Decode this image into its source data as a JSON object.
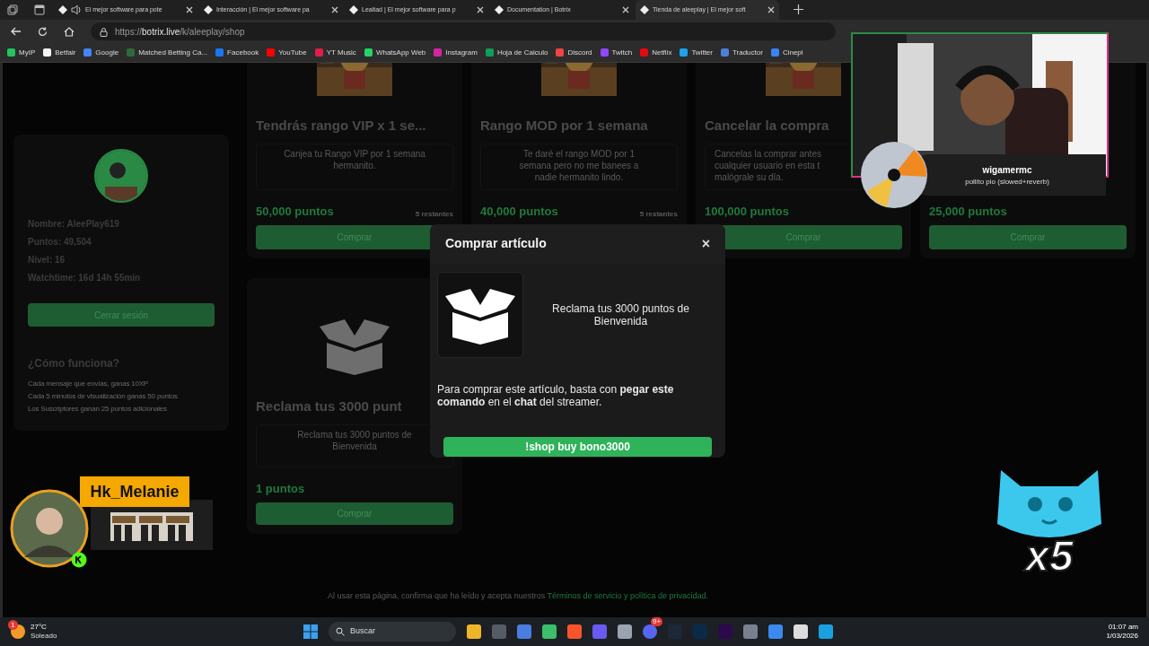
{
  "tabs": [
    {
      "title": "El mejor software para pote",
      "audio": true,
      "selected": false
    },
    {
      "title": "Interacción | El mejor software pa",
      "audio": false,
      "selected": false
    },
    {
      "title": "Lealtad | El mejor software para p",
      "audio": false,
      "selected": false
    },
    {
      "title": "Documentation | Botrix",
      "audio": false,
      "selected": false
    },
    {
      "title": "Tienda de aleeplay | El mejor soft",
      "audio": false,
      "selected": true
    }
  ],
  "address": {
    "prefix": "https://",
    "host": "botrix.live",
    "path": "/k/aleeplay/shop"
  },
  "bookmarks": [
    {
      "label": "MyIP",
      "color": "#22c55e"
    },
    {
      "label": "Betfair",
      "color": "#f5f5f5"
    },
    {
      "label": "Google",
      "color": "#4285f4"
    },
    {
      "label": "Matched Betting Ca...",
      "color": "#2f6b3a"
    },
    {
      "label": "Facebook",
      "color": "#1877f2"
    },
    {
      "label": "YouTube",
      "color": "#ff0000"
    },
    {
      "label": "YT Music",
      "color": "#e11d48"
    },
    {
      "label": "WhatsApp Web",
      "color": "#25d366"
    },
    {
      "label": "Instagram",
      "color": "#d6249f"
    },
    {
      "label": "Hoja de Calculo",
      "color": "#0f9d58"
    },
    {
      "label": "Discord",
      "color": "#ef4444"
    },
    {
      "label": "Twitch",
      "color": "#9146ff"
    },
    {
      "label": "Netflix",
      "color": "#e50914"
    },
    {
      "label": "Twitter",
      "color": "#1da1f2"
    },
    {
      "label": "Traductor",
      "color": "#4f7fd9"
    },
    {
      "label": "Cinepl",
      "color": "#3b82f6"
    }
  ],
  "profile": {
    "lines": [
      "Nombre: AleePlay619",
      "Puntos: 49,504",
      "Nivel: 16",
      "Watchtime: 16d 14h 55min"
    ],
    "logout": "Cerrar sesión",
    "how_title": "¿Cómo funciona?",
    "how_lines": [
      "Cada mensaje que envías, ganas 10XP",
      "Cada 5 minutos de visualización ganas 50 puntos",
      "Los Suscriptores ganan 25 puntos adicionales"
    ]
  },
  "cards": [
    {
      "kind": "picture",
      "title": "Tendrás rango VIP x 1 se...",
      "description": "Canjea tu Rango VIP por 1 semana\nhermanito.",
      "price": "50,000 puntos",
      "stock": "5 restantes",
      "button": "Comprar"
    },
    {
      "kind": "picture",
      "title": "Rango MOD por 1 semana",
      "description": "Te daré el rango MOD por 1\nsemana pero no me banees a\nnadie hermanito lindo.",
      "price": "40,000 puntos",
      "stock": "5 restantes"
    },
    {
      "kind": "picture",
      "title": "Cancelar la compra",
      "description": "Cancelas la comprar antes\ncualquier usuario en esta t\nmalógrale su día.",
      "price": "100,000 puntos",
      "button": "Comprar"
    },
    {
      "kind": "blank",
      "price": "25,000 puntos",
      "button": "Comprar"
    },
    {
      "kind": "box",
      "title": "Reclama tus 3000 punt",
      "description": "Reclama tus 3000 puntos de\nBienvenida",
      "price": "1 puntos",
      "button": "Comprar"
    }
  ],
  "footer": {
    "text": "Al usar esta página, confirma que ha leído y acepta nuestros ",
    "link": "Términos de servicio y política de privacidad."
  },
  "modal": {
    "title": "Comprar artículo",
    "close": "×",
    "item": "Reclama tus 3000 puntos de Bienvenida",
    "instructions": "Para comprar este artículo, basta con **pegar este comando** en el **chat** del streamer.",
    "command": "!shop buy bono3000"
  },
  "webcam": {
    "user": "wigamermc",
    "song": "pollito pio (slowed+reverb)"
  },
  "chat_alert": {
    "user": "Hk_Melanie"
  },
  "combo": {
    "count": "x5"
  },
  "taskbar": {
    "weather_badge": "1",
    "temperature": "27°C",
    "condition": "Soleado",
    "search": "Buscar",
    "discord_badge": "9+",
    "time": "01:07 am",
    "date": "1/03/2026"
  }
}
